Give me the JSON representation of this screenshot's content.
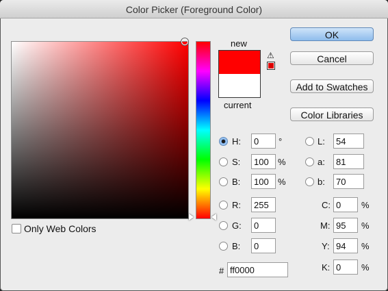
{
  "window": {
    "title": "Color Picker (Foreground Color)"
  },
  "colors": {
    "new": "#ff0000",
    "current": "#ffffff"
  },
  "preview": {
    "new_label": "new",
    "current_label": "current"
  },
  "options": {
    "only_web_colors_label": "Only Web Colors",
    "only_web_colors_checked": false
  },
  "buttons": {
    "ok": "OK",
    "cancel": "Cancel",
    "add_to_swatches": "Add to Swatches",
    "color_libraries": "Color Libraries"
  },
  "hsb": {
    "h": {
      "label": "H:",
      "value": "0",
      "unit": "°",
      "selected": true
    },
    "s": {
      "label": "S:",
      "value": "100",
      "unit": "%"
    },
    "b": {
      "label": "B:",
      "value": "100",
      "unit": "%"
    }
  },
  "rgb": {
    "r": {
      "label": "R:",
      "value": "255"
    },
    "g": {
      "label": "G:",
      "value": "0"
    },
    "b": {
      "label": "B:",
      "value": "0"
    }
  },
  "lab": {
    "l": {
      "label": "L:",
      "value": "54"
    },
    "a": {
      "label": "a:",
      "value": "81"
    },
    "b": {
      "label": "b:",
      "value": "70"
    }
  },
  "cmyk": {
    "c": {
      "label": "C:",
      "value": "0",
      "unit": "%"
    },
    "m": {
      "label": "M:",
      "value": "95",
      "unit": "%"
    },
    "y": {
      "label": "Y:",
      "value": "94",
      "unit": "%"
    },
    "k": {
      "label": "K:",
      "value": "0",
      "unit": "%"
    }
  },
  "hex": {
    "label": "#",
    "value": "ff0000"
  },
  "icons": {
    "gamut_warning": "warning-triangle-icon",
    "gamut_swatch": "gamut-swatch-icon"
  }
}
